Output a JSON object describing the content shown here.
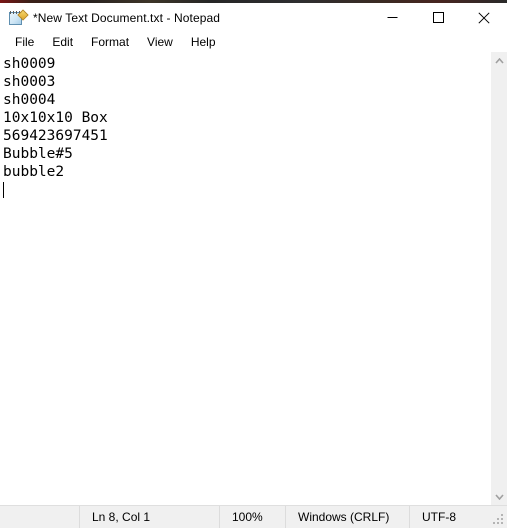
{
  "window": {
    "title": "*New Text Document.txt - Notepad",
    "icon": "notepad-icon",
    "controls": {
      "minimize_label": "Minimize",
      "maximize_label": "Maximize",
      "close_label": "Close"
    }
  },
  "menu": {
    "items": [
      {
        "label": "File"
      },
      {
        "label": "Edit"
      },
      {
        "label": "Format"
      },
      {
        "label": "View"
      },
      {
        "label": "Help"
      }
    ]
  },
  "editor": {
    "lines": [
      "sh0009",
      "sh0003",
      "sh0004",
      "10x10x10 Box",
      "569423697451",
      "Bubble#5",
      "bubble2"
    ],
    "caret_line": 8,
    "caret_column": 1
  },
  "scrollbar": {
    "up_arrow": "chevron-up-icon",
    "down_arrow": "chevron-down-icon"
  },
  "statusbar": {
    "position": "Ln 8, Col 1",
    "zoom": "100%",
    "line_ending": "Windows (CRLF)",
    "encoding": "UTF-8"
  },
  "colors": {
    "window_bg": "#ffffff",
    "chrome_bg": "#f0f0f0",
    "text": "#000000",
    "separator": "#dcdcdc",
    "scroll_arrow": "#a0a0a0"
  }
}
